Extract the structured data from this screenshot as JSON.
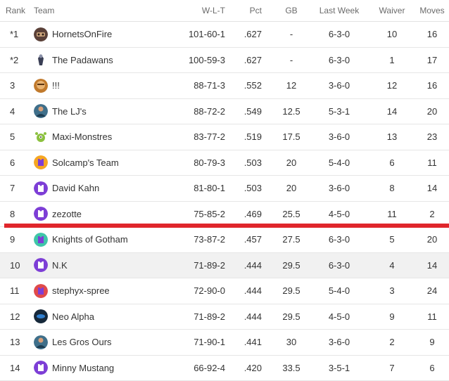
{
  "header": {
    "rank": "Rank",
    "team": "Team",
    "wlt": "W-L-T",
    "pct": "Pct",
    "gb": "GB",
    "last_week": "Last Week",
    "waiver": "Waiver",
    "moves": "Moves"
  },
  "colors": {
    "cutline": "#e0262c",
    "row_shaded": "#f1f1f1",
    "jersey_purple": "#7d3ed6"
  },
  "rows": [
    {
      "rank": "*1",
      "team": "HornetsOnFire",
      "wlt": "101-60-1",
      "pct": ".627",
      "gb": "-",
      "last_week": "6-3-0",
      "waiver": "10",
      "moves": "16",
      "avatar": "hornets-logo-icon"
    },
    {
      "rank": "*2",
      "team": "The Padawans",
      "wlt": "100-59-3",
      "pct": ".627",
      "gb": "-",
      "last_week": "6-3-0",
      "waiver": "1",
      "moves": "17",
      "avatar": "padawan-figure-icon"
    },
    {
      "rank": "3",
      "team": "!!!",
      "wlt": "88-71-3",
      "pct": ".552",
      "gb": "12",
      "last_week": "3-6-0",
      "waiver": "12",
      "moves": "16",
      "avatar": "face-photo-icon"
    },
    {
      "rank": "4",
      "team": "The LJ's",
      "wlt": "88-72-2",
      "pct": ".549",
      "gb": "12.5",
      "last_week": "5-3-1",
      "waiver": "14",
      "moves": "20",
      "avatar": "player-photo-icon"
    },
    {
      "rank": "5",
      "team": "Maxi-Monstres",
      "wlt": "83-77-2",
      "pct": ".519",
      "gb": "17.5",
      "last_week": "3-6-0",
      "waiver": "13",
      "moves": "23",
      "avatar": "green-monster-icon"
    },
    {
      "rank": "6",
      "team": "Solcamp's Team",
      "wlt": "80-79-3",
      "pct": ".503",
      "gb": "20",
      "last_week": "5-4-0",
      "waiver": "6",
      "moves": "11",
      "avatar": "jersey-orange-icon"
    },
    {
      "rank": "7",
      "team": "David Kahn",
      "wlt": "81-80-1",
      "pct": ".503",
      "gb": "20",
      "last_week": "3-6-0",
      "waiver": "8",
      "moves": "14",
      "avatar": "jersey-purple-icon"
    },
    {
      "rank": "8",
      "team": "zezotte",
      "wlt": "75-85-2",
      "pct": ".469",
      "gb": "25.5",
      "last_week": "4-5-0",
      "waiver": "11",
      "moves": "2",
      "avatar": "jersey-purple-icon"
    },
    {
      "rank": "9",
      "team": "Knights of Gotham",
      "wlt": "73-87-2",
      "pct": ".457",
      "gb": "27.5",
      "last_week": "6-3-0",
      "waiver": "5",
      "moves": "20",
      "avatar": "jersey-teal-icon"
    },
    {
      "rank": "10",
      "team": "N.K",
      "wlt": "71-89-2",
      "pct": ".444",
      "gb": "29.5",
      "last_week": "6-3-0",
      "waiver": "4",
      "moves": "14",
      "avatar": "jersey-purple-icon"
    },
    {
      "rank": "11",
      "team": "stephyx-spree",
      "wlt": "72-90-0",
      "pct": ".444",
      "gb": "29.5",
      "last_week": "5-4-0",
      "waiver": "3",
      "moves": "24",
      "avatar": "jersey-red-icon"
    },
    {
      "rank": "12",
      "team": "Neo Alpha",
      "wlt": "71-89-2",
      "pct": ".444",
      "gb": "29.5",
      "last_week": "4-5-0",
      "waiver": "9",
      "moves": "11",
      "avatar": "dark-logo-icon"
    },
    {
      "rank": "13",
      "team": "Les Gros Ours",
      "wlt": "71-90-1",
      "pct": ".441",
      "gb": "30",
      "last_week": "3-6-0",
      "waiver": "2",
      "moves": "9",
      "avatar": "player-photo-icon"
    },
    {
      "rank": "14",
      "team": "Minny Mustang",
      "wlt": "66-92-4",
      "pct": ".420",
      "gb": "33.5",
      "last_week": "3-5-1",
      "waiver": "7",
      "moves": "6",
      "avatar": "jersey-purple-icon"
    }
  ]
}
